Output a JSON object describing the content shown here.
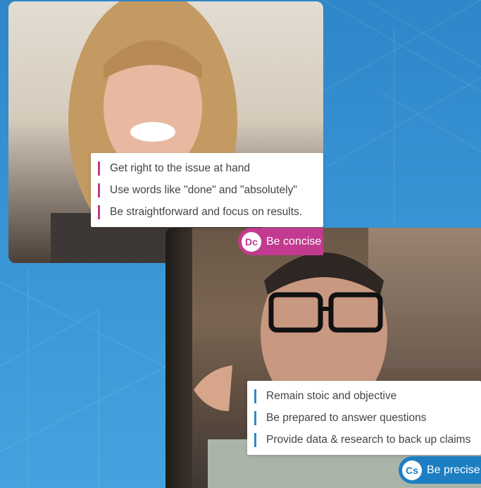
{
  "tile1": {
    "tips": [
      "Get right to the issue at hand",
      "Use words like \"done\" and \"absolutely\"",
      "Be straightforward and focus on results."
    ],
    "badge": {
      "initials": "Dc",
      "label": "Be concise",
      "color": "#c23a8f"
    }
  },
  "tile2": {
    "tips": [
      "Remain stoic and objective",
      "Be prepared to answer questions",
      "Provide data & research to back up claims"
    ],
    "badge": {
      "initials": "Cs",
      "label": "Be precise",
      "color": "#1d7fc2"
    }
  },
  "colors": {
    "background": "#3a97d6",
    "accent_pink": "#c7378c",
    "accent_blue": "#2a8ac9"
  }
}
